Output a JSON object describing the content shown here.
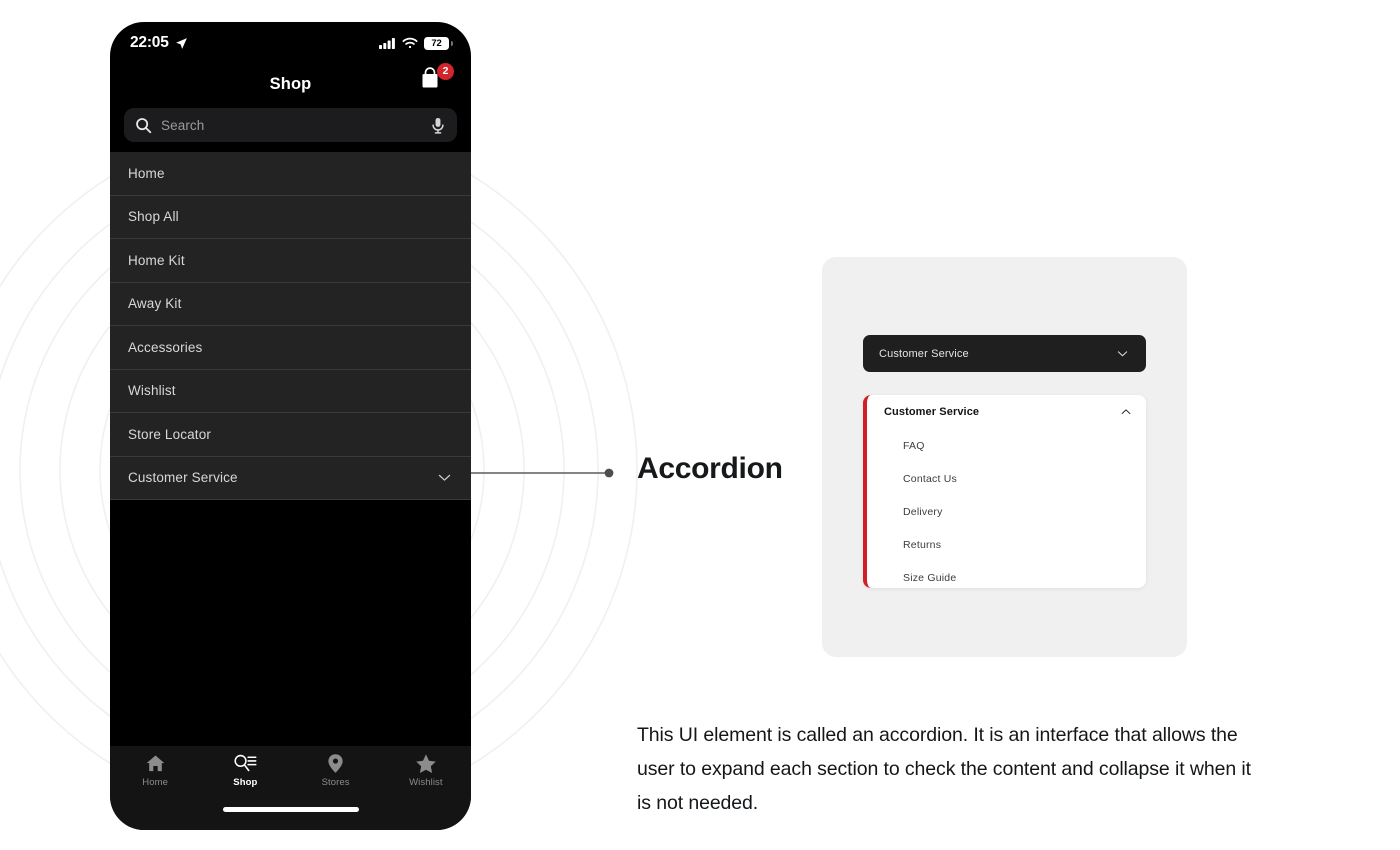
{
  "phone": {
    "status_bar": {
      "time": "22:05",
      "location_icon": "location-arrow-icon",
      "cellular_icon": "cellular-bars-icon",
      "wifi_icon": "wifi-icon",
      "battery_level": "72"
    },
    "nav": {
      "title": "Shop",
      "cart_icon": "shopping-bag-icon",
      "cart_badge": "2"
    },
    "search": {
      "placeholder": "Search",
      "value": "",
      "search_icon": "search-icon",
      "mic_icon": "microphone-icon"
    },
    "menu": {
      "items": [
        {
          "label": "Home",
          "has_chevron": false
        },
        {
          "label": "Shop All",
          "has_chevron": false
        },
        {
          "label": "Home Kit",
          "has_chevron": false
        },
        {
          "label": "Away Kit",
          "has_chevron": false
        },
        {
          "label": "Accessories",
          "has_chevron": false
        },
        {
          "label": "Wishlist",
          "has_chevron": false
        },
        {
          "label": "Store Locator",
          "has_chevron": false
        },
        {
          "label": "Customer Service",
          "has_chevron": true
        }
      ]
    },
    "tabs": [
      {
        "label": "Home",
        "icon": "home-icon",
        "active": false
      },
      {
        "label": "Shop",
        "icon": "search-list-icon",
        "active": true
      },
      {
        "label": "Stores",
        "icon": "map-pin-icon",
        "active": false
      },
      {
        "label": "Wishlist",
        "icon": "star-icon",
        "active": false
      }
    ]
  },
  "callout": {
    "label": "Accordion",
    "description": "This UI element is called an accordion. It is an interface that allows the user to expand each section to check the content and collapse it when it is not needed."
  },
  "demo": {
    "collapsed": {
      "label": "Customer Service",
      "chevron": "chevron-down-icon"
    },
    "expanded": {
      "label": "Customer Service",
      "chevron": "chevron-up-icon",
      "items": [
        {
          "label": "FAQ"
        },
        {
          "label": "Contact Us"
        },
        {
          "label": "Delivery"
        },
        {
          "label": "Returns"
        },
        {
          "label": "Size Guide"
        }
      ]
    }
  },
  "colors": {
    "accent_red": "#cf2027",
    "badge_red": "#d0262c",
    "phone_black": "#000000",
    "menu_gray": "#232323",
    "card_gray": "#f0f0f1",
    "ring_gray": "#f1f1f1"
  }
}
